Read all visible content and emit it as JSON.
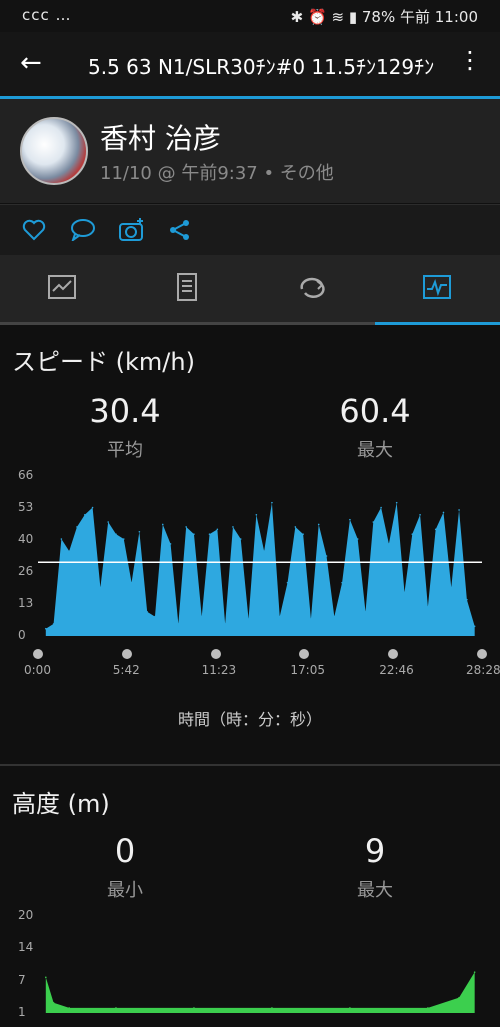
{
  "status_bar": {
    "left_icons": "ᴄᴄᴄ …",
    "right_text": "78% 午前 11:00"
  },
  "app_bar": {
    "title": "5.5 63 N1/SLR30ﾁﾝ#0 11.5ﾁﾝ129ﾁﾝ"
  },
  "profile": {
    "name": "香村 治彦",
    "meta": "11/10 @ 午前9:37 • その他"
  },
  "speed": {
    "title": "スピード (km/h)",
    "avg_value": "30.4",
    "avg_label": "平均",
    "max_value": "60.4",
    "max_label": "最大",
    "x_axis_title": "時間（時：分：秒）"
  },
  "altitude": {
    "title": "高度 (m)",
    "min_value": "0",
    "min_label": "最小",
    "max_value": "9",
    "max_label": "最大"
  },
  "chart_data": [
    {
      "type": "area",
      "title": "スピード (km/h)",
      "xlabel": "時間（時：分：秒）",
      "ylabel": "",
      "ylim": [
        0,
        66
      ],
      "yticks": [
        "66",
        "53",
        "40",
        "26",
        "13",
        "0"
      ],
      "xticks": [
        "0:00",
        "5:42",
        "11:23",
        "17:05",
        "22:46",
        "28:28"
      ],
      "average_line": 30.4,
      "color": "#2ea8e0",
      "x": [
        0.5,
        1,
        1.5,
        2,
        2.5,
        3,
        3.5,
        4,
        4.5,
        5,
        5.5,
        6,
        6.5,
        7,
        7.5,
        8,
        8.5,
        9,
        9.5,
        10,
        10.5,
        11,
        11.5,
        12,
        12.5,
        13,
        13.5,
        14,
        14.5,
        15,
        15.5,
        16,
        16.5,
        17,
        17.5,
        18,
        18.5,
        19,
        19.5,
        20,
        20.5,
        21,
        21.5,
        22,
        22.5,
        23,
        23.5,
        24,
        24.5,
        25,
        25.5,
        26,
        26.5,
        27,
        27.5,
        28
      ],
      "values": [
        3,
        5,
        40,
        35,
        45,
        50,
        53,
        20,
        47,
        42,
        40,
        22,
        43,
        10,
        8,
        46,
        38,
        5,
        45,
        42,
        8,
        42,
        44,
        5,
        45,
        40,
        7,
        50,
        35,
        55,
        8,
        22,
        45,
        42,
        7,
        46,
        33,
        8,
        22,
        48,
        40,
        10,
        47,
        53,
        38,
        55,
        18,
        42,
        50,
        12,
        44,
        51,
        20,
        52,
        15,
        4
      ]
    },
    {
      "type": "area",
      "title": "高度 (m)",
      "ylim": [
        1,
        20
      ],
      "yticks": [
        "20",
        "14",
        "7",
        "1"
      ],
      "color": "#3ccf4e",
      "x": [
        0.5,
        1,
        2,
        5,
        10,
        15,
        20,
        25,
        27,
        28
      ],
      "values": [
        8,
        3,
        2,
        2,
        2,
        2,
        2,
        2,
        4,
        9
      ]
    }
  ]
}
